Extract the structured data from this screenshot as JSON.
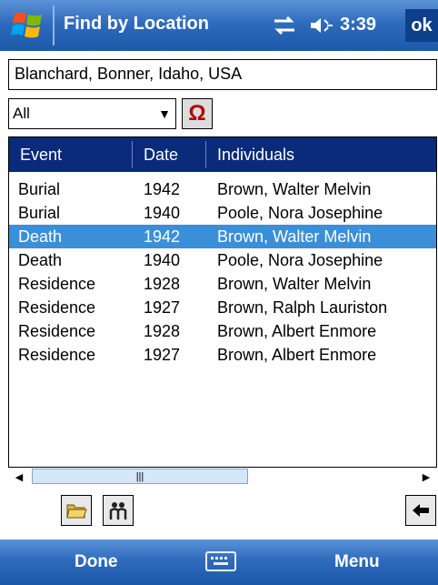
{
  "titlebar": {
    "title": "Find by Location",
    "time": "3:39",
    "ok_label": "ok"
  },
  "location_field": {
    "value": "Blanchard, Bonner, Idaho, USA"
  },
  "filter": {
    "selected": "All",
    "special_char_button": "Ω"
  },
  "table": {
    "headers": {
      "event": "Event",
      "date": "Date",
      "individuals": "Individuals"
    },
    "rows": [
      {
        "event": "Burial",
        "date": "1942",
        "individual": "Brown, Walter Melvin",
        "selected": false
      },
      {
        "event": "Burial",
        "date": "1940",
        "individual": "Poole, Nora Josephine",
        "selected": false
      },
      {
        "event": "Death",
        "date": "1942",
        "individual": "Brown, Walter Melvin",
        "selected": true
      },
      {
        "event": "Death",
        "date": "1940",
        "individual": "Poole, Nora Josephine",
        "selected": false
      },
      {
        "event": "Residence",
        "date": "1928",
        "individual": "Brown, Walter Melvin",
        "selected": false
      },
      {
        "event": "Residence",
        "date": "1927",
        "individual": "Brown, Ralph Lauriston",
        "selected": false
      },
      {
        "event": "Residence",
        "date": "1928",
        "individual": "Brown, Albert Enmore",
        "selected": false
      },
      {
        "event": "Residence",
        "date": "1927",
        "individual": "Brown, Albert Enmore",
        "selected": false
      }
    ]
  },
  "softkeys": {
    "left": "Done",
    "right": "Menu"
  },
  "colors": {
    "title_bar": "#2f6bbd",
    "header": "#0a2a7a",
    "selection": "#3a8fd8",
    "omega": "#b00000"
  }
}
